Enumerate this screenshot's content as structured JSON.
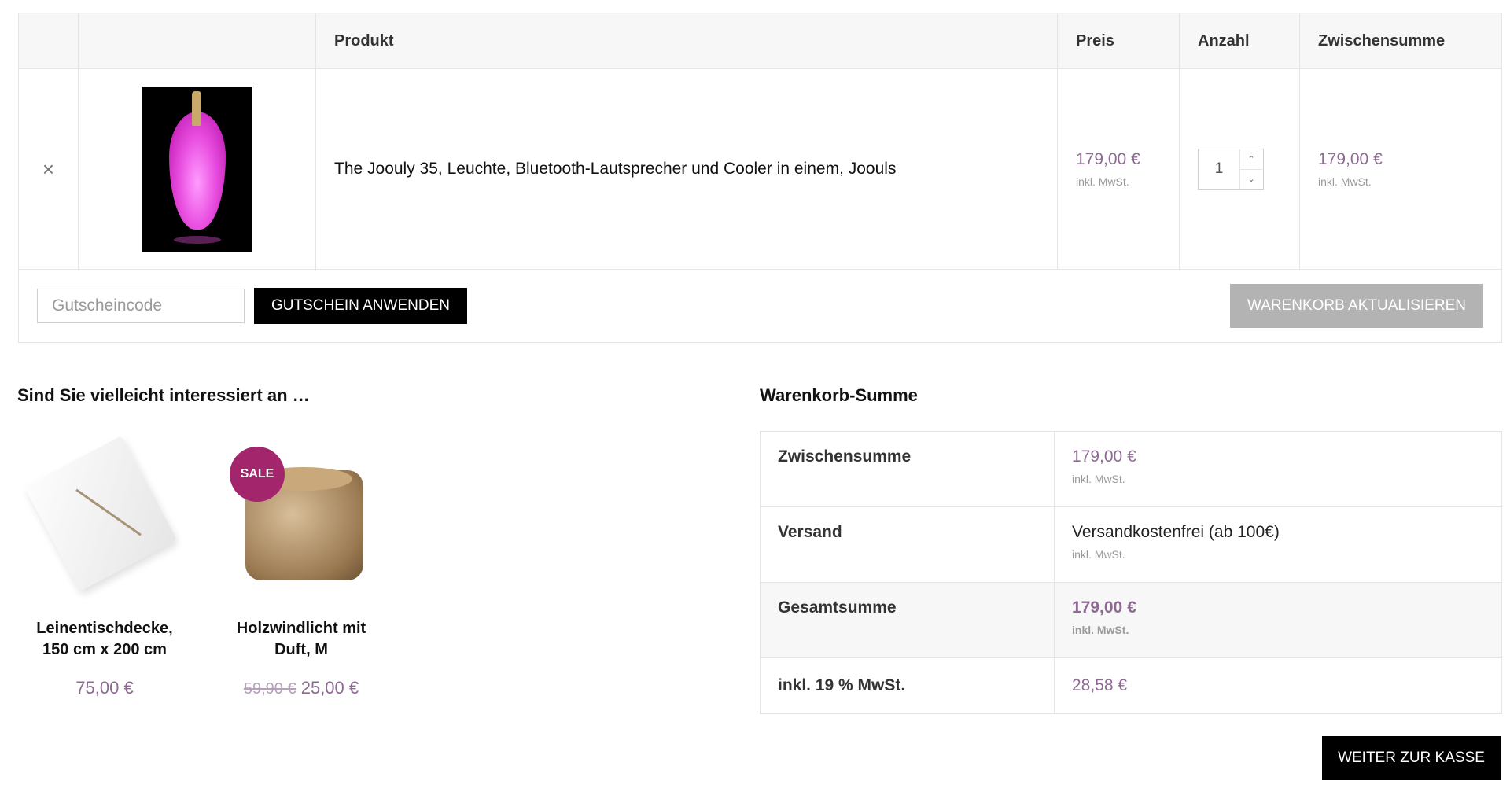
{
  "cart": {
    "headers": [
      "",
      "",
      "Produkt",
      "Preis",
      "Anzahl",
      "Zwischensumme"
    ],
    "item": {
      "remove_symbol": "×",
      "name": "The Joouly 35, Leuchte, Bluetooth-Lautsprecher und Cooler in einem, Joouls",
      "price": "179,00 €",
      "price_tax": "inkl. MwSt.",
      "quantity": "1",
      "subtotal": "179,00 €",
      "subtotal_tax": "inkl. MwSt."
    },
    "coupon_placeholder": "Gutscheincode",
    "coupon_button": "GUTSCHEIN ANWENDEN",
    "update_button": "WARENKORB AKTUALISIEREN"
  },
  "cross_sells": {
    "title": "Sind Sie vielleicht interessiert an …",
    "products": [
      {
        "name": "Leinentischdecke, 150 cm x 200 cm",
        "price": "75,00 €"
      },
      {
        "name": "Holzwindlicht mit Duft, M",
        "badge": "SALE",
        "old_price": "59,90 €",
        "price": "25,00 €"
      }
    ]
  },
  "totals": {
    "title": "Warenkorb-Summe",
    "rows": [
      {
        "label": "Zwischensumme",
        "value": "179,00 €",
        "note": "inkl. MwSt."
      },
      {
        "label": "Versand",
        "value": "Versandkostenfrei (ab 100€)",
        "note": "inkl. MwSt."
      },
      {
        "label": "Gesamtsumme",
        "value": "179,00 €",
        "note": "inkl. MwSt."
      },
      {
        "label": "inkl. 19 % MwSt.",
        "value": "28,58 €"
      }
    ],
    "checkout_button": "WEITER ZUR KASSE"
  },
  "colors": {
    "price": "#8e6a93",
    "sale_badge": "#a3266d",
    "button": "#000000",
    "button_disabled": "#b3b3b3"
  }
}
